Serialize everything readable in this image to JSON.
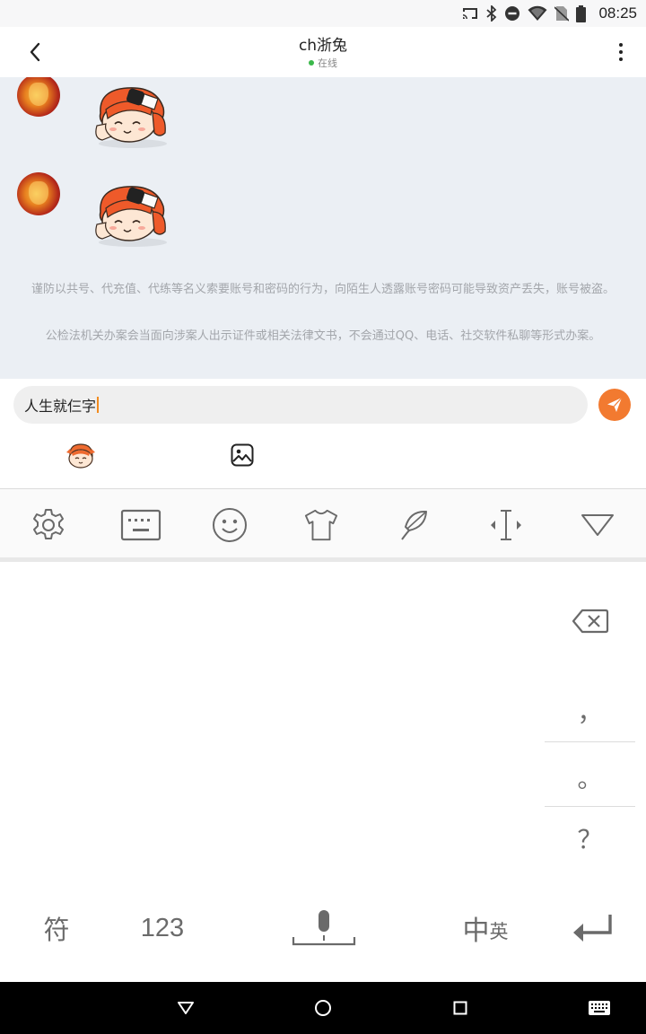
{
  "status_bar": {
    "time": "08:25",
    "icons": [
      "cast-icon",
      "bluetooth-icon",
      "do-not-disturb-icon",
      "wifi-icon",
      "no-sim-icon",
      "battery-icon"
    ]
  },
  "header": {
    "title": "ch浙兔",
    "status": "在线",
    "status_color": "#3bb84a",
    "back_icon": "chevron-left-icon",
    "more_icon": "more-vertical-icon"
  },
  "chat": {
    "background": "#ebeff4",
    "messages": [
      {
        "sender": "other",
        "type": "sticker"
      },
      {
        "sender": "other",
        "type": "sticker"
      }
    ],
    "notices": [
      "谨防以共号、代充值、代练等名义索要账号和密码的行为，向陌生人透露账号密码可能导致资产丢失，账号被盗。",
      "公检法机关办案会当面向涉案人出示证件或相关法律文书，不会通过QQ、电话、社交软件私聊等形式办案。"
    ]
  },
  "composer": {
    "input_value": "人生就仨字",
    "caret_color": "#f28b1f",
    "send_icon": "send-icon",
    "send_color": "#f27a30",
    "tools": [
      "sticker-icon",
      "image-icon"
    ]
  },
  "keyboard": {
    "toolbar": [
      "settings-icon",
      "keyboard-icon",
      "emoji-icon",
      "skin-icon",
      "handwriting-icon",
      "cursor-move-icon",
      "collapse-icon"
    ],
    "punctuation": [
      "，",
      "。",
      "？"
    ],
    "bottom": {
      "symbols": "符",
      "numbers": "123",
      "lang_main": "中",
      "lang_sub": "英"
    }
  },
  "nav_bar": [
    "back-triangle-icon",
    "home-circle-icon",
    "recents-square-icon",
    "keyboard-switch-icon"
  ]
}
